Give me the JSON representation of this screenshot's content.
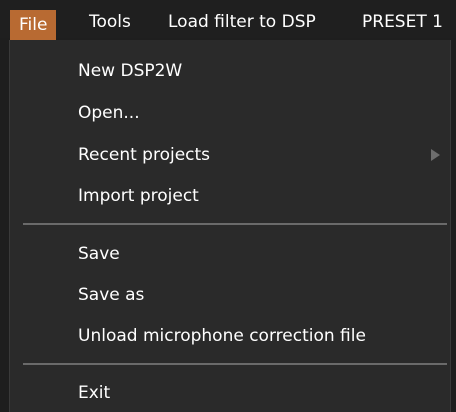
{
  "menubar": {
    "file": "File",
    "tools": "Tools",
    "load_filter": "Load filter to DSP",
    "preset": "PRESET 1"
  },
  "file_menu": {
    "items": [
      {
        "label": "New DSP2W"
      },
      {
        "label": "Open..."
      },
      {
        "label": "Recent projects"
      },
      {
        "label": "Import project"
      },
      {
        "label": "Save"
      },
      {
        "label": "Save as"
      },
      {
        "label": "Unload microphone correction file"
      },
      {
        "label": "Exit"
      }
    ]
  },
  "colors": {
    "active_menu": "#b86a32",
    "menu_background": "#2a2a2a",
    "separator": "#6a6a6a"
  },
  "icons": {
    "submenu": "chevron-right-icon"
  }
}
